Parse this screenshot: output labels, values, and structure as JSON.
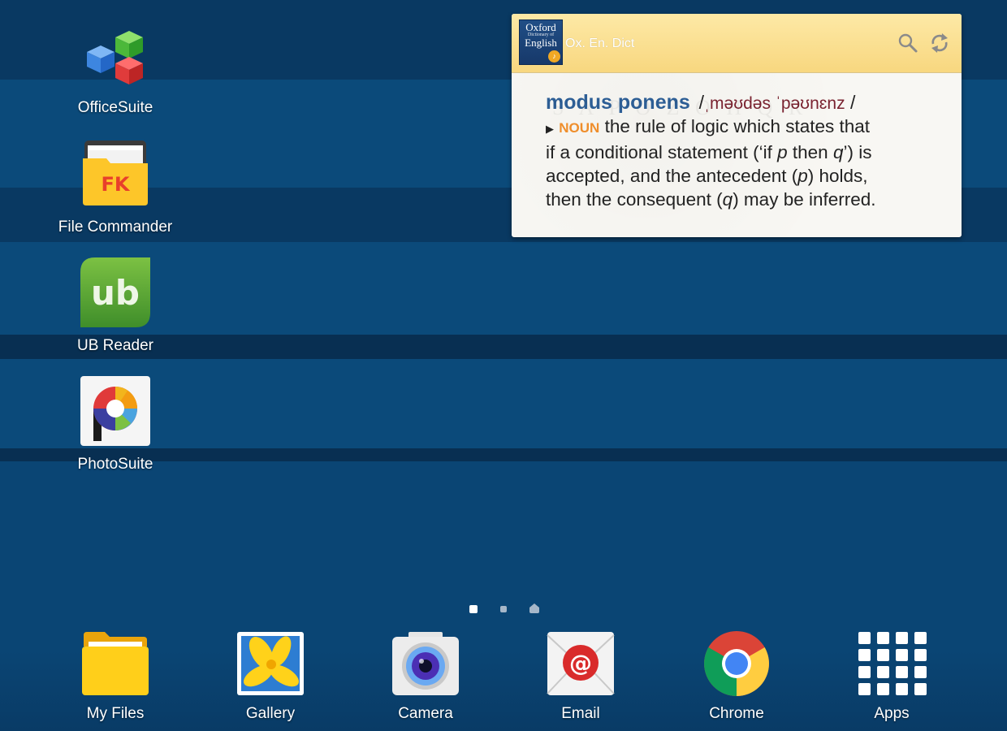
{
  "desktop": {
    "apps": [
      {
        "label": "OfficeSuite"
      },
      {
        "label": "File Commander"
      },
      {
        "label": "UB Reader"
      },
      {
        "label": "PhotoSuite"
      }
    ]
  },
  "widget": {
    "logo": {
      "line1": "Oxford",
      "line2": "Dictionary of",
      "line3": "English"
    },
    "title": "Ox. En. Dict",
    "headword": "modus ponens",
    "pronunciation": "ˌməʊdəs ˈpəʊnɛnz",
    "part_of_speech": "NOUN",
    "definition": {
      "l1": "the rule of logic which states that",
      "l2a": "if a conditional statement (‘if ",
      "l2b": "p",
      "l2c": " then ",
      "l2d": "q",
      "l2e": "’) is",
      "l3a": "accepted, and the antecedent (",
      "l3b": "p",
      "l3c": ") holds,",
      "l4a": "then the consequent (",
      "l4b": "q",
      "l4c": ") may be inferred."
    },
    "icons": {
      "search": "search-icon",
      "refresh": "refresh-icon"
    }
  },
  "page_indicator": {
    "pages": 3,
    "current": 1
  },
  "dock": {
    "apps": [
      {
        "label": "My Files"
      },
      {
        "label": "Gallery"
      },
      {
        "label": "Camera"
      },
      {
        "label": "Email"
      },
      {
        "label": "Chrome"
      },
      {
        "label": "Apps"
      }
    ]
  },
  "colors": {
    "headword": "#2d5e95",
    "pronunciation": "#7a2330",
    "part_of_speech": "#ef8e2b",
    "widget_header": "#f8d77f"
  }
}
